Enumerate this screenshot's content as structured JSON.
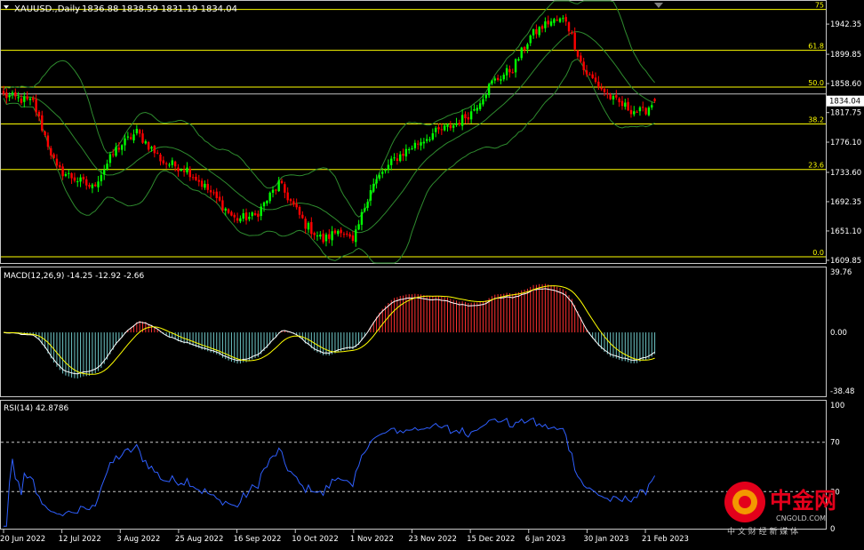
{
  "colors": {
    "background": "#000000",
    "frame": "#c8c8c8",
    "text": "#ffffff",
    "bull_candle": "#00ff00",
    "bear_candle": "#ff0000",
    "bollinger": "#2e8b2e",
    "fibonacci": "#ffff00",
    "level_line": "#c0c0c0",
    "macd_hist_up": "#ff3030",
    "macd_hist_down": "#6ec6c6",
    "macd_line": "#ffffff",
    "signal_line": "#ffff00",
    "rsi_line": "#2f5fff",
    "logo_red": "#e3001b",
    "logo_orange": "#f39800"
  },
  "header": {
    "symbol": "XAUUSD.,Daily",
    "ohlc": "1836.88 1838.59 1831.19 1834.04"
  },
  "price_panel": {
    "price_ticks": [
      "1942.35",
      "1899.85",
      "1858.60",
      "1817.75",
      "1776.10",
      "1733.60",
      "1692.35",
      "1651.10",
      "1609.85"
    ],
    "current_price": "1834.04",
    "fibonacci": [
      {
        "label": "75",
        "value": 1963.0
      },
      {
        "label": "61.8",
        "value": 1905.4
      },
      {
        "label": "50.0",
        "value": 1853.6
      },
      {
        "label": "38.2",
        "value": 1801.8
      },
      {
        "label": "23.6",
        "value": 1737.7
      },
      {
        "label": "0.0",
        "value": 1614.8
      }
    ],
    "level_line_value": 1844.0
  },
  "macd_panel": {
    "title": "MACD(12,26,9) -14.25 -12.92 -2.66",
    "ticks": [
      "39.76",
      "0.00",
      "-38.48"
    ]
  },
  "rsi_panel": {
    "title": "RSI(14) 42.8786",
    "ticks": [
      "100",
      "70",
      "30",
      "0"
    ],
    "levels": [
      70,
      30
    ]
  },
  "x_axis": {
    "labels": [
      "20 Jun 2022",
      "12 Jul 2022",
      "3 Aug 2022",
      "25 Aug 2022",
      "16 Sep 2022",
      "10 Oct 2022",
      "1 Nov 2022",
      "23 Nov 2022",
      "15 Dec 2022",
      "6 Jan 2023",
      "30 Jan 2023",
      "21 Feb 2023"
    ]
  },
  "watermark": {
    "brand": "中金网",
    "domain": "CNGOLD.COM",
    "tagline": "中 文 财 经 新 媒 体"
  },
  "chart_data": {
    "type": "candlestick",
    "title": "XAUUSD.,Daily",
    "ylim": [
      1606,
      1975
    ],
    "x": [
      "20 Jun 2022",
      "12 Jul 2022",
      "3 Aug 2022",
      "25 Aug 2022",
      "16 Sep 2022",
      "10 Oct 2022",
      "1 Nov 2022",
      "23 Nov 2022",
      "15 Dec 2022",
      "6 Jan 2023",
      "30 Jan 2023",
      "21 Feb 2023"
    ],
    "close_anchors": [
      [
        0,
        1842
      ],
      [
        10,
        1832
      ],
      [
        18,
        1738
      ],
      [
        30,
        1712
      ],
      [
        38,
        1766
      ],
      [
        45,
        1790
      ],
      [
        54,
        1748
      ],
      [
        62,
        1738
      ],
      [
        70,
        1705
      ],
      [
        78,
        1668
      ],
      [
        85,
        1672
      ],
      [
        93,
        1718
      ],
      [
        102,
        1660
      ],
      [
        108,
        1638
      ],
      [
        114,
        1655
      ],
      [
        118,
        1633
      ],
      [
        124,
        1712
      ],
      [
        132,
        1752
      ],
      [
        138,
        1770
      ],
      [
        145,
        1788
      ],
      [
        152,
        1800
      ],
      [
        158,
        1818
      ],
      [
        165,
        1860
      ],
      [
        172,
        1880
      ],
      [
        178,
        1925
      ],
      [
        184,
        1945
      ],
      [
        190,
        1949
      ],
      [
        196,
        1878
      ],
      [
        200,
        1860
      ],
      [
        206,
        1835
      ],
      [
        212,
        1822
      ],
      [
        216,
        1818
      ],
      [
        220,
        1834
      ]
    ],
    "series": [
      {
        "name": "MACD(12,26,9)",
        "last": -14.25
      },
      {
        "name": "Signal",
        "last": -12.92
      },
      {
        "name": "Histogram",
        "last": -2.66
      },
      {
        "name": "RSI(14)",
        "last": 42.8786
      }
    ],
    "fibonacci_levels": [
      {
        "ratio": "75",
        "price": 1963.0
      },
      {
        "ratio": "61.8",
        "price": 1905.4
      },
      {
        "ratio": "50.0",
        "price": 1853.6
      },
      {
        "ratio": "38.2",
        "price": 1801.8
      },
      {
        "ratio": "23.6",
        "price": 1737.7
      },
      {
        "ratio": "0.0",
        "price": 1614.8
      }
    ],
    "rsi_levels": [
      70,
      30
    ],
    "macd_range": [
      -38.48,
      39.76
    ]
  }
}
